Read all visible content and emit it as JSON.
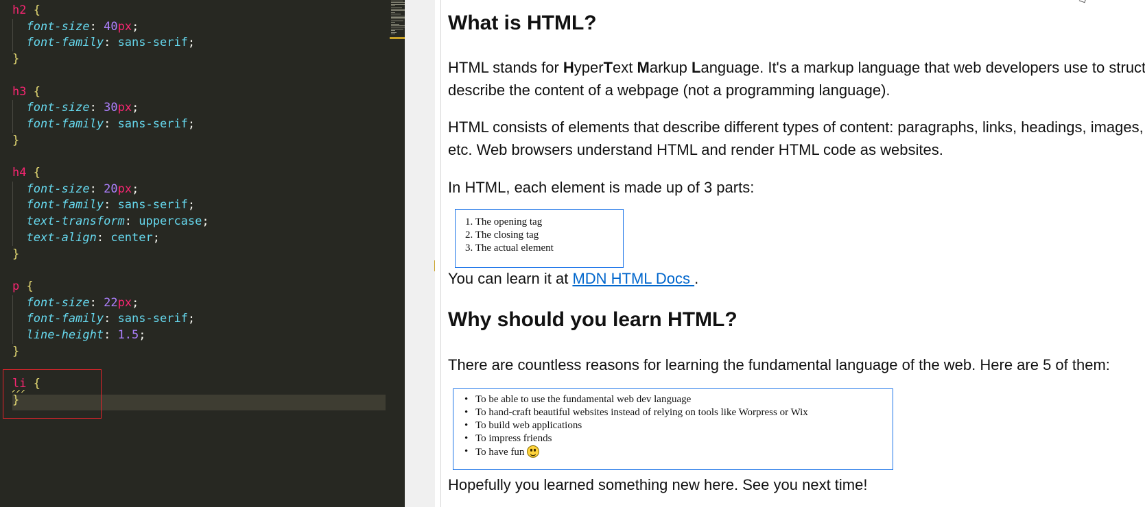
{
  "editor": {
    "lines": [
      {
        "sel": "h2",
        "open": "{"
      },
      {
        "prop": "font-size",
        "num": "40",
        "unit": "px"
      },
      {
        "prop": "font-family",
        "kw": "sans-serif"
      },
      {
        "close": "}"
      },
      {
        "sel": "h3",
        "open": "{"
      },
      {
        "prop": "font-size",
        "num": "30",
        "unit": "px"
      },
      {
        "prop": "font-family",
        "kw": "sans-serif"
      },
      {
        "close": "}"
      },
      {
        "sel": "h4",
        "open": "{"
      },
      {
        "prop": "font-size",
        "num": "20",
        "unit": "px"
      },
      {
        "prop": "font-family",
        "kw": "sans-serif"
      },
      {
        "prop": "text-transform",
        "kw": "uppercase"
      },
      {
        "prop": "text-align",
        "kw": "center"
      },
      {
        "close": "}"
      },
      {
        "sel": "p",
        "open": "{"
      },
      {
        "prop": "font-size",
        "num": "22",
        "unit": "px"
      },
      {
        "prop": "font-family",
        "kw": "sans-serif"
      },
      {
        "prop": "line-height",
        "num": "1.5",
        "unit": ""
      },
      {
        "close": "}"
      },
      {
        "sel": "li",
        "open": "{"
      },
      {
        "close": "}"
      }
    ],
    "colors": {
      "background": "#272822",
      "selector": "#f92672",
      "property": "#66d9ef",
      "number": "#ae81ff",
      "brace": "#e6db74",
      "highlight_box": "#e8242c"
    }
  },
  "preview": {
    "heading1": "What is HTML?",
    "para1_parts": [
      "HTML stands for ",
      "H",
      "yper",
      "T",
      "ext ",
      "M",
      "arkup ",
      "L",
      "anguage. It's a markup language that web developers use to structure and"
    ],
    "para1_line2": "describe the content of a webpage (not a programming language).",
    "para2_line1": "HTML consists of elements that describe different types of content: paragraphs, links, headings, images, video,",
    "para2_line2": "etc. Web browsers understand HTML and render HTML code as websites.",
    "para3": "In HTML, each element is made up of 3 parts:",
    "ordered_list": [
      "1. The opening tag",
      "2. The closing tag",
      "3. The actual element"
    ],
    "para4_prefix": "You can learn it at ",
    "para4_link": "MDN HTML Docs ",
    "para4_suffix": ".",
    "heading2": "Why should you learn HTML?",
    "para5": "There are countless reasons for learning the fundamental language of the web. Here are 5 of them:",
    "unordered_list": [
      "To be able to use the fundamental web dev language",
      "To hand-craft beautiful websites instead of relying on tools like Worpress or Wix",
      "To build web applications",
      "To impress friends",
      "To have fun"
    ],
    "para6": "Hopefully you learned something new here. See you next time!",
    "colors": {
      "link": "#0066cc",
      "list_border": "#1a73e8",
      "emoji": "#ffd43b"
    }
  }
}
